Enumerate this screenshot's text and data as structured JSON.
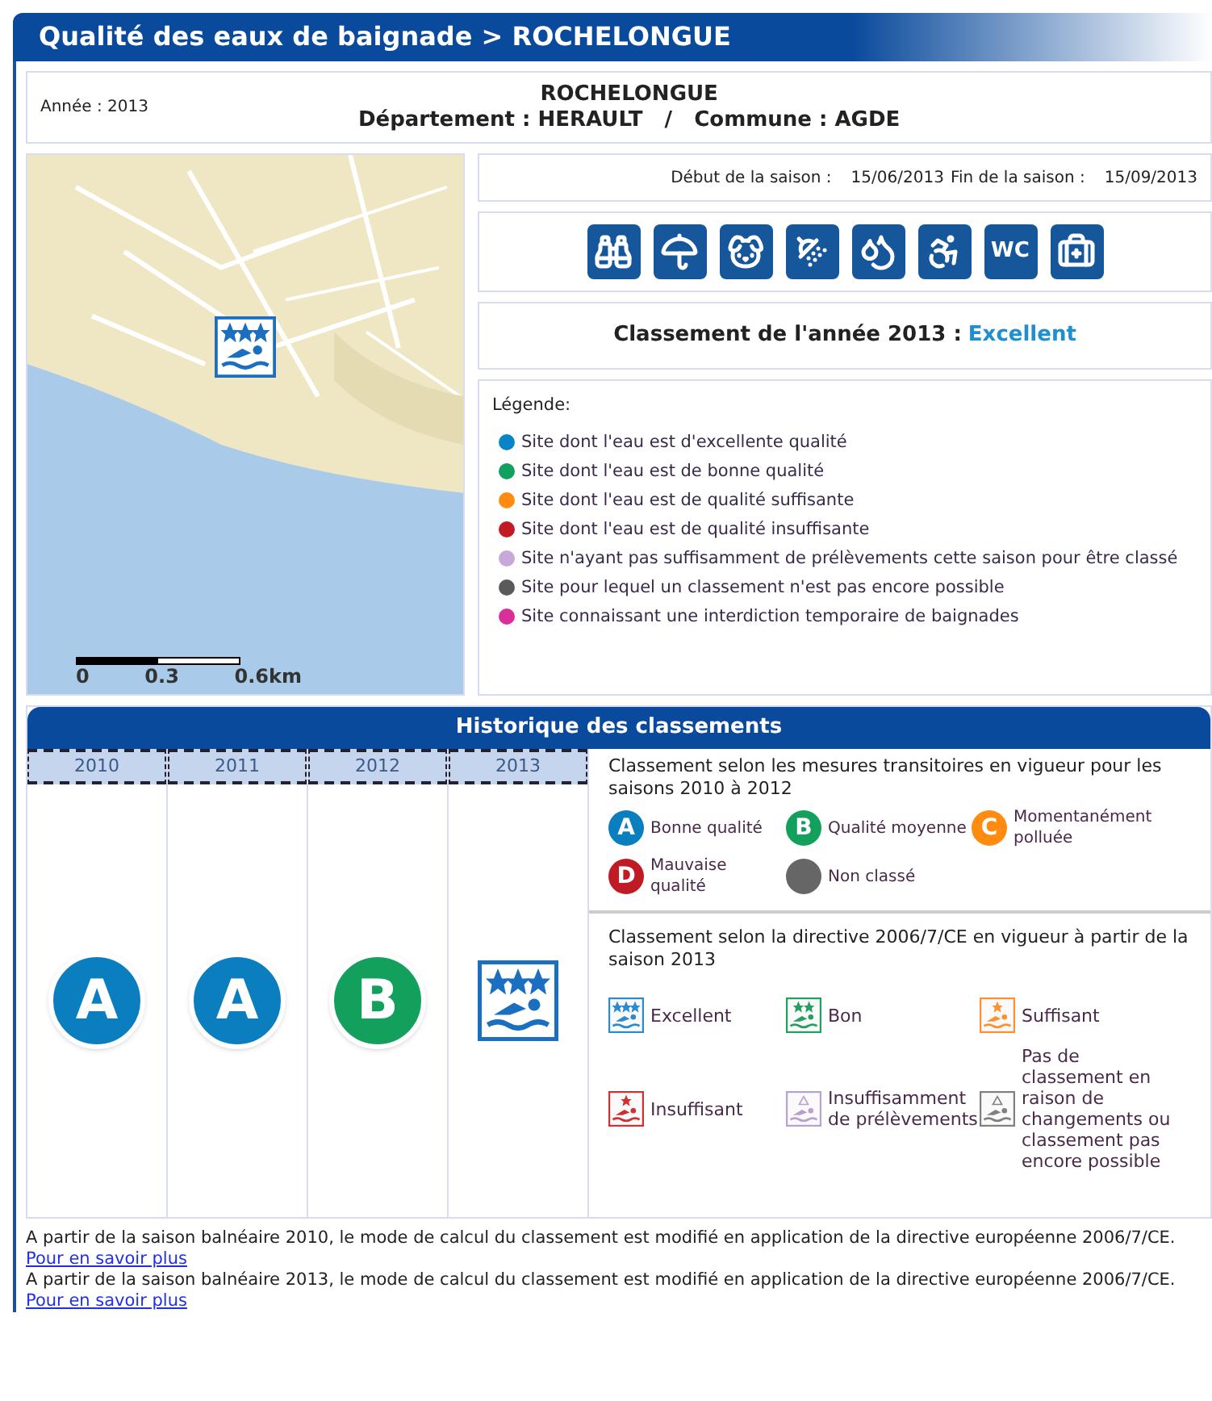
{
  "header": {
    "title": "Qualité des eaux de baignade > ROCHELONGUE"
  },
  "site": {
    "year_label": "Année : 2013",
    "name": "ROCHELONGUE",
    "location": "Département : HERAULT   /   Commune : AGDE"
  },
  "map": {
    "kind": "picture",
    "marker": {
      "kind": "three-star"
    },
    "scale": [
      "0",
      "0.3",
      "0.6km"
    ]
  },
  "season": {
    "start_label": "Début de la saison :",
    "start": "15/06/2013",
    "end_label": "Fin de la saison :",
    "end": "15/09/2013"
  },
  "amenities": [
    {
      "kind": "binoculars"
    },
    {
      "kind": "umbrella"
    },
    {
      "kind": "dog"
    },
    {
      "kind": "shower"
    },
    {
      "kind": "tap"
    },
    {
      "kind": "wheelchair"
    },
    {
      "kind": "wc",
      "label": "WC"
    },
    {
      "kind": "first-aid"
    }
  ],
  "ranking": {
    "label": "Classement de l'année 2013 :",
    "value": "Excellent"
  },
  "legend": {
    "title": "Légende:",
    "items": [
      {
        "text": "Site dont l'eau est d'excellente qualité",
        "color": "#0a84c6"
      },
      {
        "text": "Site dont l'eau est de bonne qualité",
        "color": "#10a060"
      },
      {
        "text": "Site dont l'eau est de qualité suffisante",
        "color": "#ff8c10"
      },
      {
        "text": "Site dont l'eau est de qualité insuffisante",
        "color": "#c01a24"
      },
      {
        "text": "Site n'ayant pas suffisamment de prélèvements cette saison pour être classé",
        "color": "#c8a8d8"
      },
      {
        "text": "Site pour lequel un classement n'est pas encore possible",
        "color": "#5a5a5a"
      },
      {
        "text": "Site connaissant une interdiction temporaire de baignades",
        "color": "#d83098"
      }
    ]
  },
  "history": {
    "title": "Historique des classements",
    "years": [
      {
        "year": "2010",
        "kind": "letter",
        "letter": "A",
        "color": "#0a7ebf"
      },
      {
        "year": "2011",
        "kind": "letter",
        "letter": "A",
        "color": "#0a7ebf"
      },
      {
        "year": "2012",
        "kind": "letter",
        "letter": "B",
        "color": "#13a05c"
      },
      {
        "year": "2013",
        "kind": "three-star",
        "color": "#1a6fc0"
      }
    ],
    "transitional": {
      "title": "Classement selon les mesures transitoires en vigueur pour les saisons 2010 à 2012",
      "items": [
        {
          "letter": "A",
          "color": "#0a7ebf",
          "label": "Bonne qualité"
        },
        {
          "letter": "B",
          "color": "#13a05c",
          "label": "Qualité moyenne"
        },
        {
          "letter": "C",
          "color": "#ff8c10",
          "label": "Momentanément polluée"
        },
        {
          "letter": "D",
          "color": "#c01a24",
          "label": "Mauvaise qualité"
        },
        {
          "color": "#666666",
          "label": "Non classé"
        }
      ]
    },
    "directive": {
      "title": "Classement selon la directive 2006/7/CE en vigueur à partir de la saison 2013",
      "items": [
        {
          "label": "Excellent",
          "kind": "three-star",
          "color": "#2a8bd0"
        },
        {
          "label": "Bon",
          "kind": "two-star",
          "color": "#23a060"
        },
        {
          "label": "Suffisant",
          "kind": "one-star",
          "color": "#ff9030"
        },
        {
          "label": "Insuffisant",
          "kind": "one-star",
          "color": "#d03030"
        },
        {
          "label": "Insuffisamment de prélèvements",
          "kind": "no-star",
          "color": "#b8a0d0"
        },
        {
          "label": "Pas de classement en raison de changements ou classement pas encore possible",
          "kind": "no-star",
          "color": "#808080"
        }
      ]
    }
  },
  "notes": [
    {
      "text": "A partir de la saison balnéaire 2010, le mode de calcul du classement est modifié en application de la directive européenne 2006/7/CE.",
      "link": "Pour en savoir plus"
    },
    {
      "text": "A partir de la saison balnéaire 2013, le mode de calcul du classement est modifié en application de la directive européenne 2006/7/CE.",
      "link": "Pour en savoir plus"
    }
  ]
}
